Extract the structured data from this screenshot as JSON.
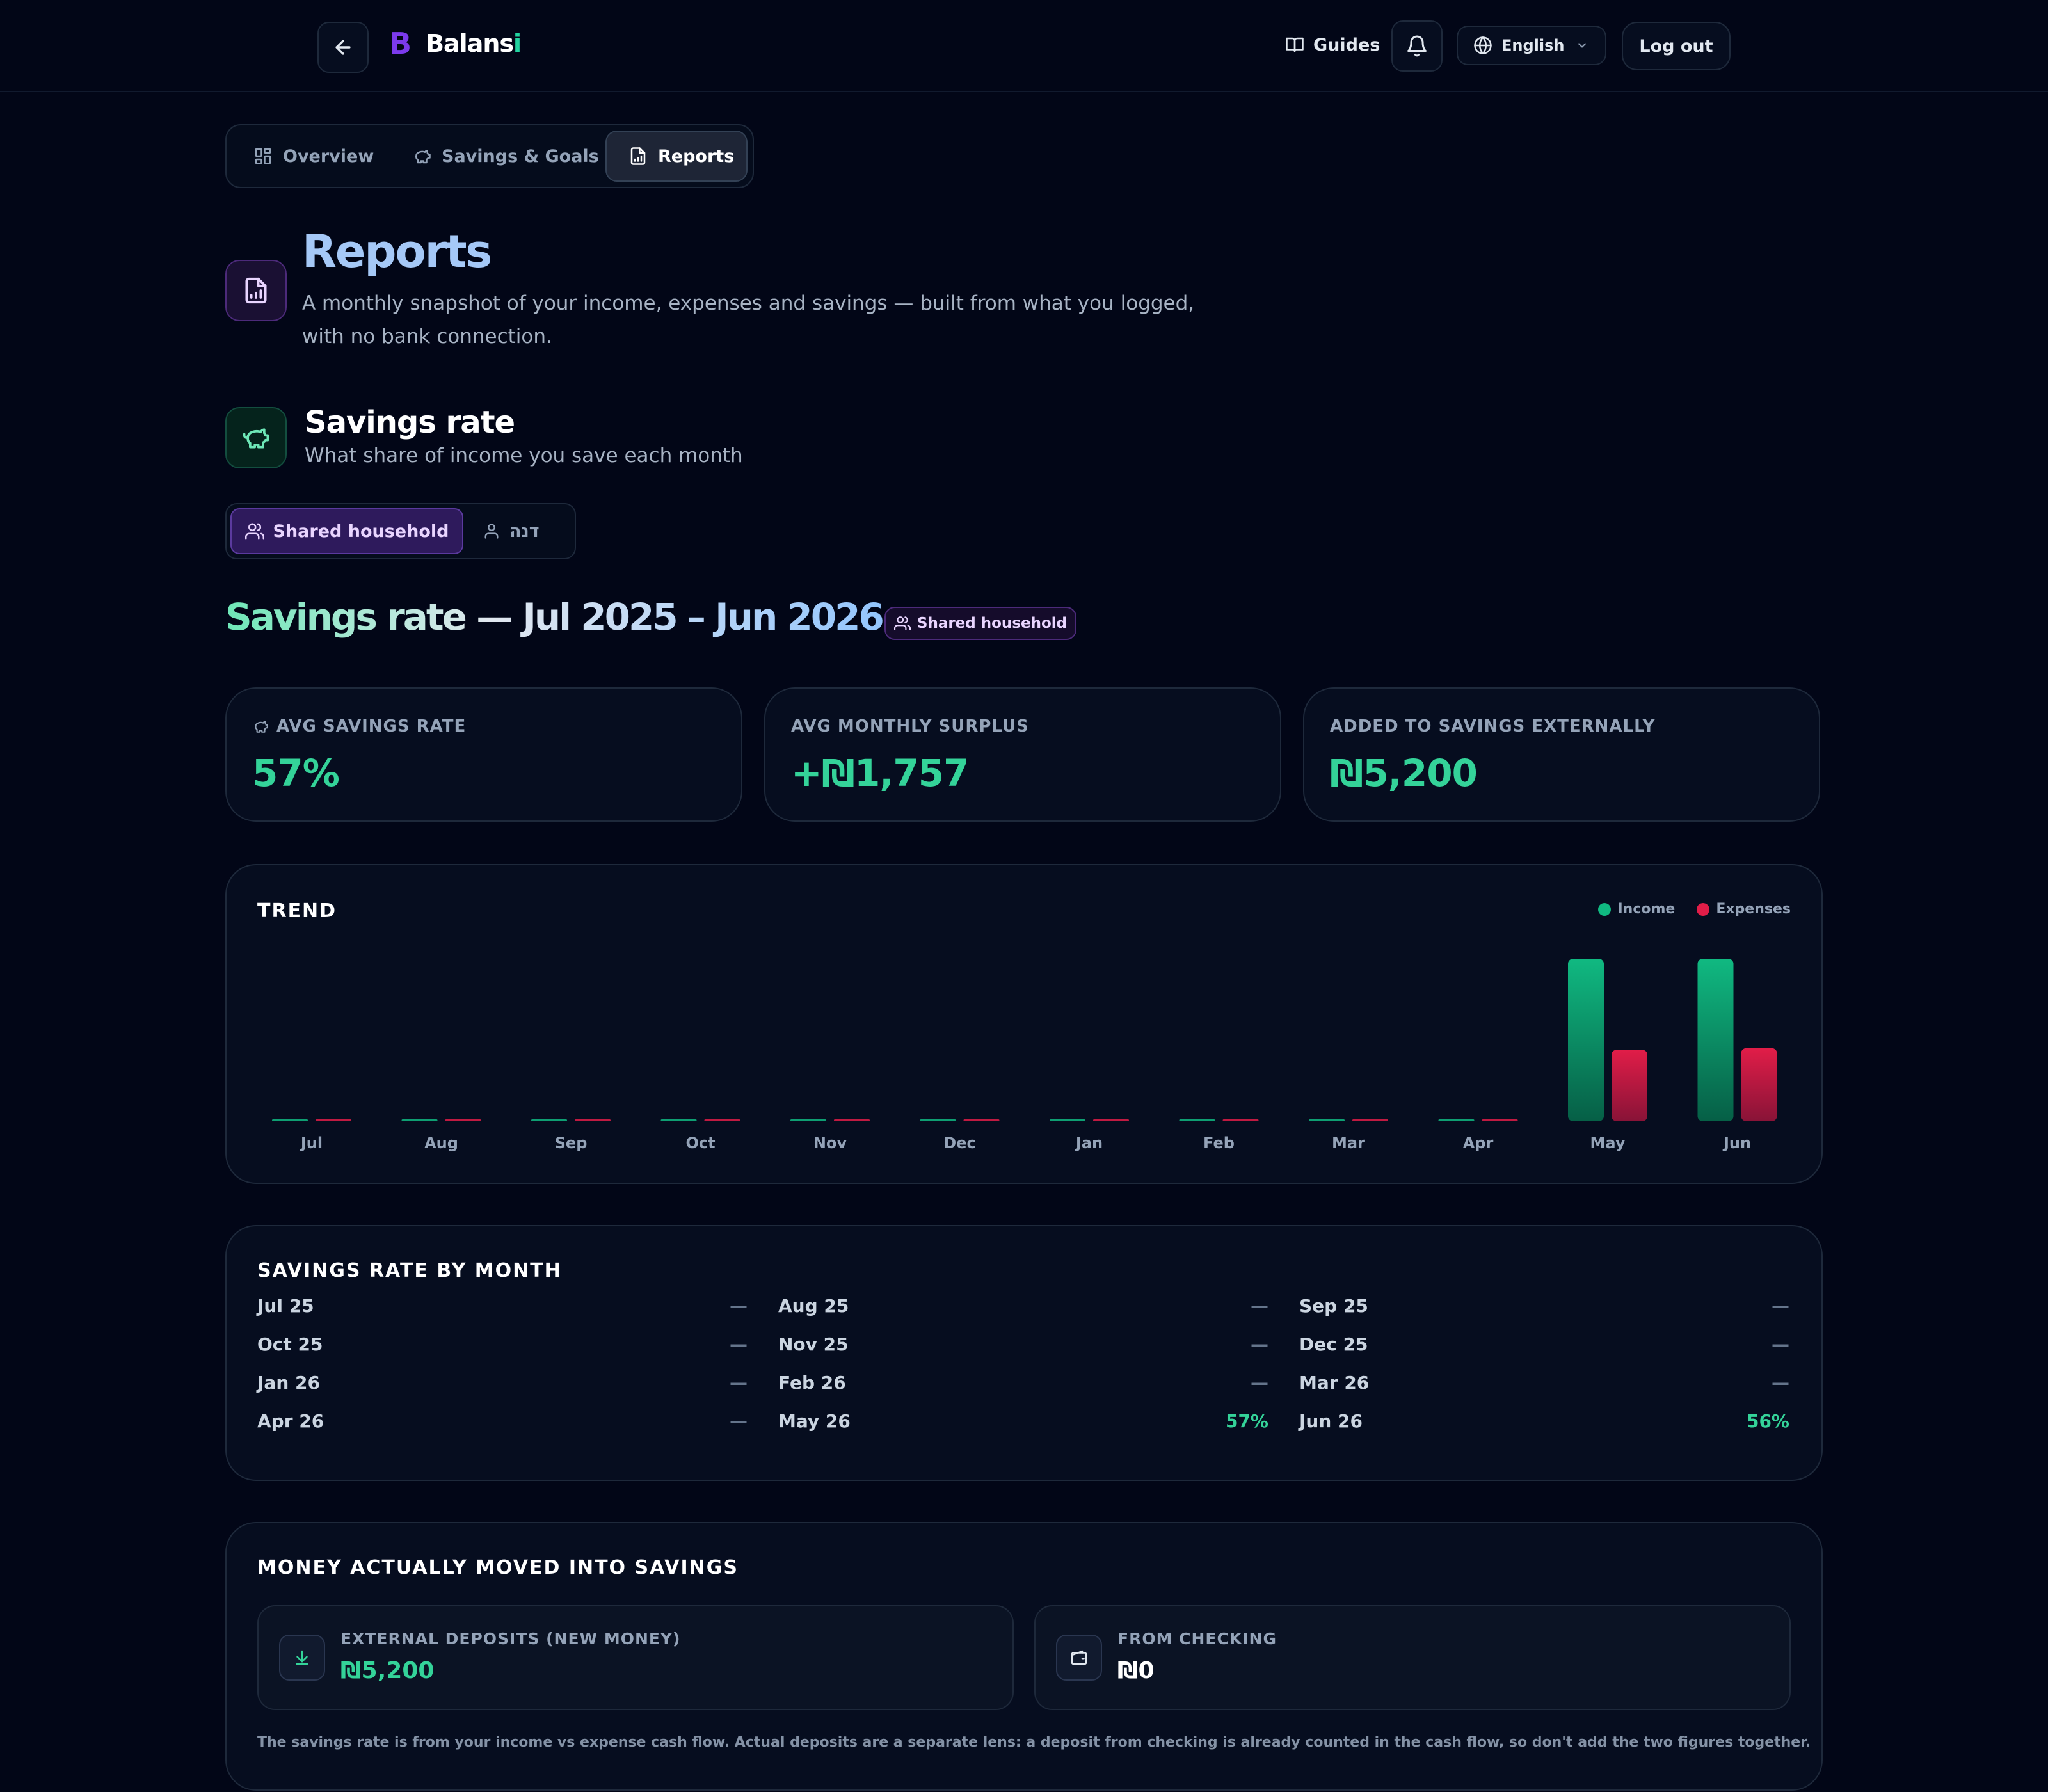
{
  "header": {
    "brand": {
      "name_main": "Balans",
      "name_accent": "i",
      "mark": "B"
    },
    "guides_label": "Guides",
    "language": "English",
    "logout_label": "Log out"
  },
  "tabs": [
    {
      "label": "Overview",
      "icon": "grid-icon",
      "active": false
    },
    {
      "label": "Savings & Goals",
      "icon": "piggy-bank-icon",
      "active": false
    },
    {
      "label": "Reports",
      "icon": "report-icon",
      "active": true
    }
  ],
  "page": {
    "title": "Reports",
    "subtitle_line1": "A monthly snapshot of your income, expenses and savings — built from what you logged,",
    "subtitle_line2": "with no bank connection."
  },
  "savings_section": {
    "title": "Savings rate",
    "subtitle": "What share of income you save each month",
    "segment": {
      "shared": "Shared household",
      "personal": "דנה"
    },
    "range_title": "Savings rate — Jul 2025 – Jun 2026",
    "range_badge": "Shared household"
  },
  "stats": [
    {
      "label": "AVG SAVINGS RATE",
      "value": "57%",
      "icon": "piggy-bank-icon"
    },
    {
      "label": "AVG MONTHLY SURPLUS",
      "value": "+₪1,757"
    },
    {
      "label": "ADDED TO SAVINGS EXTERNALLY",
      "value": "₪5,200"
    }
  ],
  "trend": {
    "title": "TREND",
    "legend": {
      "income": "Income",
      "expenses": "Expenses"
    }
  },
  "chart_data": {
    "type": "bar",
    "title": "TREND",
    "categories": [
      "Jul",
      "Aug",
      "Sep",
      "Oct",
      "Nov",
      "Dec",
      "Jan",
      "Feb",
      "Mar",
      "Apr",
      "May",
      "Jun"
    ],
    "series": [
      {
        "name": "Income",
        "color": "#10b981",
        "values": [
          0,
          0,
          0,
          0,
          0,
          0,
          0,
          0,
          0,
          0,
          1,
          1
        ]
      },
      {
        "name": "Expenses",
        "color": "#e11d48",
        "values": [
          0,
          0,
          0,
          0,
          0,
          0,
          0,
          0,
          0,
          0,
          0.44,
          0.45
        ]
      }
    ],
    "ylim": [
      0,
      1
    ],
    "grid": false,
    "legend_position": "top-right"
  },
  "by_month": {
    "title": "SAVINGS RATE BY MONTH",
    "rows": [
      {
        "month": "Jul 25",
        "value": "—"
      },
      {
        "month": "Aug 25",
        "value": "—"
      },
      {
        "month": "Sep 25",
        "value": "—"
      },
      {
        "month": "Oct 25",
        "value": "—"
      },
      {
        "month": "Nov 25",
        "value": "—"
      },
      {
        "month": "Dec 25",
        "value": "—"
      },
      {
        "month": "Jan 26",
        "value": "—"
      },
      {
        "month": "Feb 26",
        "value": "—"
      },
      {
        "month": "Mar 26",
        "value": "—"
      },
      {
        "month": "Apr 26",
        "value": "—"
      },
      {
        "month": "May 26",
        "value": "57%"
      },
      {
        "month": "Jun 26",
        "value": "56%"
      }
    ]
  },
  "moved": {
    "title": "MONEY ACTUALLY MOVED INTO SAVINGS",
    "external": {
      "label": "EXTERNAL DEPOSITS (NEW MONEY)",
      "value": "₪5,200",
      "color": "#34d399"
    },
    "checking": {
      "label": "FROM CHECKING",
      "value": "₪0",
      "color": "#ffffff"
    },
    "footnote": "The savings rate is from your income vs expense cash flow. Actual deposits are a separate lens: a deposit from checking is already counted in the cash flow, so don't add the two figures together."
  },
  "colors": {
    "background": "#020617",
    "accent_green": "#34d399",
    "accent_purple": "#7c3aed",
    "income": "#10b981",
    "expenses": "#e11d48"
  }
}
